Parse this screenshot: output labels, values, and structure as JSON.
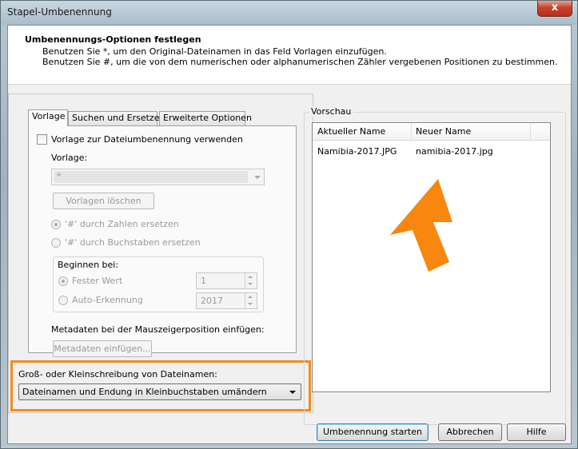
{
  "window": {
    "title": "Stapel-Umbenennung",
    "close_glyph": "x"
  },
  "header": {
    "title": "Umbenennungs-Optionen festlegen",
    "line1": "Benutzen Sie *, um den Original-Dateinamen in das Feld Vorlagen einzufügen.",
    "line2": "Benutzen Sie #, um die von dem numerischen oder alphanumerischen Zähler vergebenen Positionen zu bestimmen."
  },
  "tabs": [
    {
      "label": "Vorlage",
      "active": true
    },
    {
      "label": "Suchen und Ersetzen",
      "active": false
    },
    {
      "label": "Erweiterte Optionen",
      "active": false
    }
  ],
  "template": {
    "use_template_label": "Vorlage zur Dateiumbenennung verwenden",
    "use_template_checked": false,
    "template_label": "Vorlage:",
    "template_value": "*",
    "delete_templates_button": "Vorlagen löschen",
    "replace_numbers_label": "'#' durch Zahlen ersetzen",
    "replace_letters_label": "'#' durch Buchstaben ersetzen",
    "start_group_label": "Beginnen bei:",
    "fixed_value_label": "Fester Wert",
    "fixed_value": "1",
    "auto_detect_label": "Auto-Erkennung",
    "auto_detect_value": "2017",
    "metadata_label": "Metadaten bei der Mauszeigerposition einfügen:",
    "insert_metadata_button": "Metadaten einfügen..."
  },
  "case": {
    "label": "Groß- oder Kleinschreibung von Dateinamen:",
    "selected": "Dateinamen und Endung in Kleinbuchstaben umändern",
    "highlight_color": "#f28c1e"
  },
  "preview": {
    "label": "Vorschau",
    "columns": [
      "Aktueller Name",
      "Neuer Name"
    ],
    "rows": [
      {
        "current": "Namibia-2017.JPG",
        "new": "namibia-2017.jpg"
      }
    ],
    "arrow_color": "#f7870f"
  },
  "buttons": {
    "start": "Umbenennung starten",
    "cancel": "Abbrechen",
    "help": "Hilfe"
  }
}
